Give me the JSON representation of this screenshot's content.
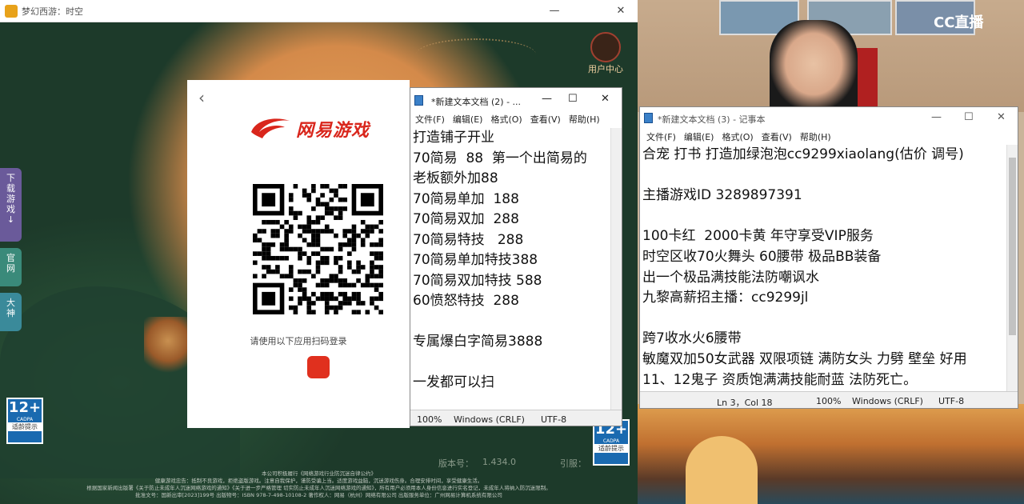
{
  "game_window": {
    "title": "梦幻西游：时空",
    "minimize": "—",
    "close": "✕",
    "side_tabs": {
      "download": [
        "下",
        "载",
        "游",
        "戏",
        "↓"
      ],
      "official": [
        "官",
        "网"
      ],
      "dashen": [
        "大",
        "神"
      ]
    },
    "user_center": "用户中心",
    "age_badge": {
      "number": "12+",
      "org": "CADPA",
      "tip": "适龄提示"
    },
    "version_label": "版本号：",
    "version_value": "1.434.0",
    "guide_label": "引服：",
    "footer_lines": [
      "本公司积极履行《网络游戏行业防沉迷自律公约》",
      "健康游戏忠告：抵制不良游戏，拒绝盗版游戏。注意自我保护，谨防受骗上当。适度游戏益脑，沉迷游戏伤身。合理安排时间，享受健康生活。",
      "根据国家新闻出版署《关于防止未成年人沉迷网络游戏的通知》《关于进一步严格管理 切实防止未成年人沉迷网络游戏的通知》，所有用户必须用本人身份信息进行实名登记，未成年人将纳入防沉迷限制。",
      "批准文号：国新出审[2023]199号 出版物号：ISBN 978-7-498-10108-2 著作权人：网易（杭州）网络有限公司 出版服务单位：广州网易计算机系统有限公司"
    ]
  },
  "login_popup": {
    "back": "‹",
    "logo_text": "网易游戏",
    "hint": "请使用以下应用扫码登录"
  },
  "notepad_left": {
    "title": "*新建文本文档 (2) - ...",
    "menu": [
      "文件(F)",
      "编辑(E)",
      "格式(O)",
      "查看(V)",
      "帮助(H)"
    ],
    "lines": [
      "打造铺子开业",
      "70简易  88  第一个出简易的",
      "老板额外加88",
      "70简易单加  188",
      "70简易双加  288",
      "70简易特技   288",
      "70简易单加特技388",
      "70简易双加特技 588",
      "60愤怒特技  288",
      "",
      "专属爆白字简易3888",
      "",
      "一发都可以扫"
    ],
    "status": {
      "zoom": "100%",
      "eol": "Windows (CRLF)",
      "encoding": "UTF-8"
    }
  },
  "notepad_right": {
    "title": "*新建文本文档 (3) - 记事本",
    "menu": [
      "文件(F)",
      "编辑(E)",
      "格式(O)",
      "查看(V)",
      "帮助(H)"
    ],
    "lines": [
      "合宠 打书 打造加绿泡泡cc9299xiaolang(估价 调号)",
      "",
      "主播游戏ID 3289897391",
      "",
      "100卡红  2000卡黄 年守享受VIP服务",
      "时空区收70火舞头 60腰带 极品BB装备",
      "出一个极品满技能法防嘲讽水",
      "九黎高薪招主播：cc9299jl",
      "",
      "跨7收水火6腰带",
      "敏魔双加50女武器 双限项链 满防女头 力劈 壁垒 好用",
      "11、12鬼子 资质饱满满技能耐蓝 法防死亡。"
    ],
    "status": {
      "position": "Ln 3，Col 18",
      "zoom": "100%",
      "eol": "Windows (CRLF)",
      "encoding": "UTF-8"
    }
  },
  "stream": {
    "brand": "CC直播"
  }
}
